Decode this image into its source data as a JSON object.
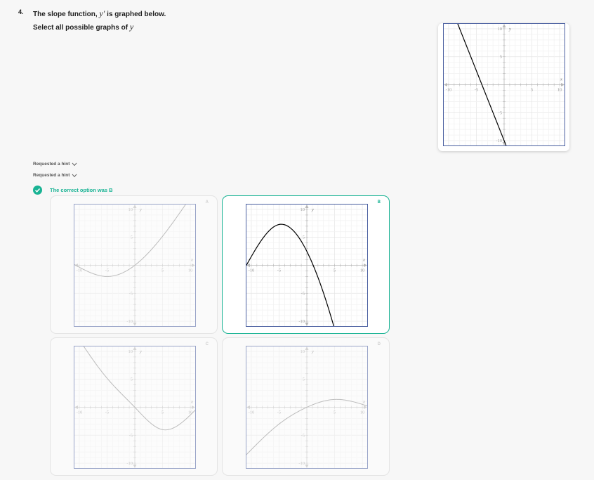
{
  "question": {
    "number": "4.",
    "line1_prefix": "The slope function, ",
    "line1_symbol": "y′",
    "line1_suffix": " is graphed below.",
    "line2_prefix": "Select all possible graphs of ",
    "line2_symbol": "y"
  },
  "hints": [
    "Requested a hint",
    "Requested a hint"
  ],
  "feedback": {
    "text": "The correct option was B"
  },
  "axis_ticks": {
    "left": "-10",
    "neg5": "-5",
    "pos5": "5",
    "right": "10",
    "top": "10",
    "mid_up": "5",
    "mid_down": "-5",
    "bottom": "-10"
  },
  "axis_labels": {
    "x": "x",
    "y": "y"
  },
  "colors": {
    "accent": "#19b394",
    "curve_ref": "#000000",
    "curve_option": "#8a8a8a",
    "graph_border": "#4a5fa0"
  },
  "options": [
    {
      "letter": "A",
      "selected": false
    },
    {
      "letter": "B",
      "selected": true
    },
    {
      "letter": "C",
      "selected": false
    },
    {
      "letter": "D",
      "selected": false
    }
  ],
  "chart_data": [
    {
      "type": "line",
      "name": "reference",
      "x": [
        -10,
        10
      ],
      "y": [
        15,
        -35
      ],
      "xlim": [
        -11,
        11
      ],
      "ylim": [
        -11,
        11
      ],
      "grid": true
    },
    {
      "type": "line",
      "name": "A",
      "x": [
        -11,
        -5,
        0,
        5,
        11
      ],
      "y": [
        0.2,
        -2.0,
        0,
        5.2,
        13.6
      ],
      "xlim": [
        -11,
        11
      ],
      "ylim": [
        -11,
        11
      ],
      "grid": true
    },
    {
      "type": "line",
      "name": "B",
      "x": [
        -11,
        -5,
        0,
        5,
        11
      ],
      "y": [
        -0.2,
        7.3,
        2.5,
        -11.4,
        -35.3
      ],
      "xlim": [
        -11,
        11
      ],
      "ylim": [
        -11,
        11
      ],
      "grid": true
    },
    {
      "type": "line",
      "name": "C",
      "x": [
        -11,
        -5,
        0,
        5,
        11
      ],
      "y": [
        13.6,
        5.2,
        0,
        -4.0,
        -0.4
      ],
      "xlim": [
        -11,
        11
      ],
      "ylim": [
        -11,
        11
      ],
      "grid": true
    },
    {
      "type": "line",
      "name": "D",
      "x": [
        -11,
        -5,
        0,
        5,
        11
      ],
      "y": [
        -8.6,
        -3.0,
        0,
        1.4,
        0.2
      ],
      "xlim": [
        -11,
        11
      ],
      "ylim": [
        -11,
        11
      ],
      "grid": true
    }
  ]
}
